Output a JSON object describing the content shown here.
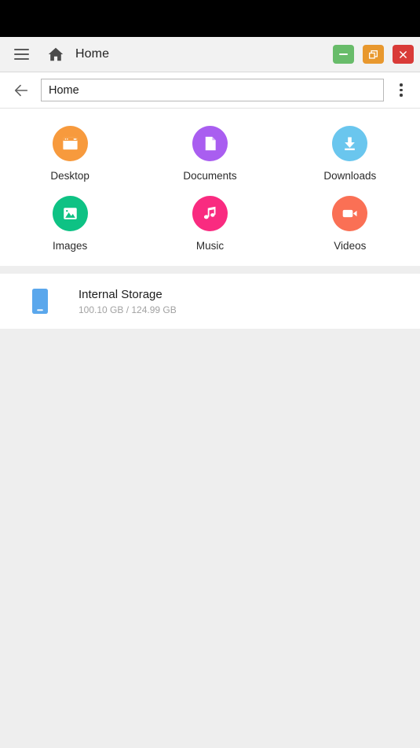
{
  "window": {
    "title": "Home",
    "menu_icon": "hamburger-menu-icon",
    "home_icon": "home-icon",
    "controls": {
      "minimize_label": "–",
      "restore_label": "❐",
      "close_label": "✕",
      "minimize_color": "#68bc6a",
      "restore_color": "#e8982e",
      "close_color": "#d93b38"
    }
  },
  "addressbar": {
    "back_icon": "arrow-left-icon",
    "path_value": "Home",
    "path_placeholder": "Home",
    "overflow_icon": "more-vertical-icon"
  },
  "shortcuts": [
    {
      "label": "Desktop",
      "icon": "desktop-window-icon",
      "color": "#f79a3d"
    },
    {
      "label": "Documents",
      "icon": "document-page-icon",
      "color": "#a95ef0"
    },
    {
      "label": "Downloads",
      "icon": "download-arrow-icon",
      "color": "#6ac6ee"
    },
    {
      "label": "Images",
      "icon": "photo-image-icon",
      "color": "#0ec284"
    },
    {
      "label": "Music",
      "icon": "music-note-icon",
      "color": "#f92b80"
    },
    {
      "label": "Videos",
      "icon": "video-camera-icon",
      "color": "#fa7055"
    }
  ],
  "storage": {
    "icon": "phone-storage-icon",
    "icon_color": "#5aa7ec",
    "title": "Internal Storage",
    "usage": "100.10 GB / 124.99 GB"
  }
}
